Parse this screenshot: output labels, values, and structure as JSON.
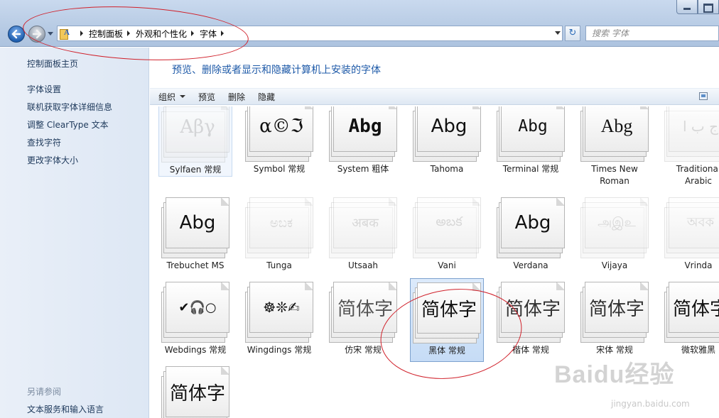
{
  "address": {
    "crumbs": [
      "控制面板",
      "外观和个性化",
      "字体"
    ],
    "search_placeholder": "搜索 字体"
  },
  "sidebar": {
    "home": "控制面板主页",
    "links": [
      "字体设置",
      "联机获取字体详细信息",
      "调整 ClearType 文本",
      "查找字符",
      "更改字体大小"
    ],
    "see_also_title": "另请参阅",
    "see_also": [
      "文本服务和输入语言"
    ]
  },
  "main": {
    "title": "预览、删除或者显示和隐藏计算机上安装的字体"
  },
  "toolbar": {
    "organize": "组织",
    "preview": "预览",
    "delete": "删除",
    "hide": "隐藏"
  },
  "fonts": [
    {
      "name": "Sylfaen 常规",
      "sample": "Αβγ"
    },
    {
      "name": "Symbol 常规",
      "sample": "α©ℑ"
    },
    {
      "name": "System 粗体",
      "sample": "Abg"
    },
    {
      "name": "Tahoma",
      "sample": "Abg"
    },
    {
      "name": "Terminal 常规",
      "sample": "Abg"
    },
    {
      "name": "Times New Roman",
      "sample": "Abg"
    },
    {
      "name": "Traditional Arabic",
      "sample": "ج ب ا"
    },
    {
      "name": "Trebuchet MS",
      "sample": "Abg"
    },
    {
      "name": "Tunga",
      "sample": "ಅಬಕ"
    },
    {
      "name": "Utsaah",
      "sample": "अबक"
    },
    {
      "name": "Vani",
      "sample": "అబక"
    },
    {
      "name": "Verdana",
      "sample": "Abg"
    },
    {
      "name": "Vijaya",
      "sample": "அஇஉ"
    },
    {
      "name": "Vrinda",
      "sample": "অবক"
    },
    {
      "name": "Webdings 常规",
      "sample": "✔🎧○"
    },
    {
      "name": "Wingdings 常规",
      "sample": "☸❊✍"
    },
    {
      "name": "仿宋 常规",
      "sample": "简体字"
    },
    {
      "name": "黑体 常规",
      "sample": "简体字"
    },
    {
      "name": "楷体 常规",
      "sample": "简体字"
    },
    {
      "name": "宋体 常规",
      "sample": "简体字"
    },
    {
      "name": "微软雅黑",
      "sample": "简体字"
    },
    {
      "name": "",
      "sample": "简体字"
    }
  ],
  "watermark": {
    "text": "Baidu经验",
    "url": "jingyan.baidu.com"
  }
}
